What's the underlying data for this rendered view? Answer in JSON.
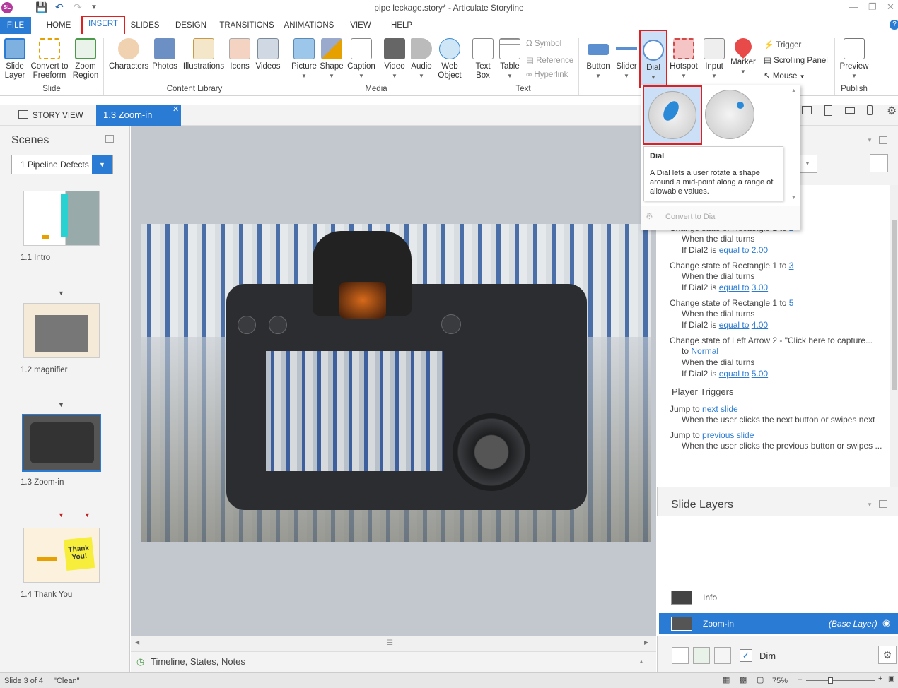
{
  "window": {
    "app_icon": "SL",
    "title": "pipe leckage.story* - Articulate Storyline"
  },
  "tabs": [
    "FILE",
    "HOME",
    "INSERT",
    "SLIDES",
    "DESIGN",
    "TRANSITIONS",
    "ANIMATIONS",
    "VIEW",
    "HELP"
  ],
  "ribbon": {
    "slide_group": {
      "label": "Slide",
      "buttons": [
        "Slide Layer",
        "Convert to Freeform",
        "Zoom Region"
      ]
    },
    "content_library": {
      "label": "Content Library",
      "buttons": [
        "Characters",
        "Photos",
        "Illustrations",
        "Icons",
        "Videos"
      ]
    },
    "media": {
      "label": "Media",
      "buttons": [
        "Picture",
        "Shape",
        "Caption",
        "Video",
        "Audio",
        "Web Object"
      ]
    },
    "text": {
      "label": "Text",
      "buttons": [
        "Text Box",
        "Table"
      ],
      "small": [
        "Symbol",
        "Reference",
        "Hyperlink"
      ]
    },
    "interactive": {
      "buttons": [
        "Button",
        "Slider",
        "Dial",
        "Hotspot",
        "Input",
        "Marker"
      ],
      "small": [
        "Trigger",
        "Scrolling Panel",
        "Mouse"
      ]
    },
    "publish": {
      "label": "Publish",
      "buttons": [
        "Preview"
      ]
    }
  },
  "view_tabs": {
    "story_view": "STORY VIEW",
    "current": "1.3 Zoom-in"
  },
  "scenes": {
    "title": "Scenes",
    "dropdown": "1 Pipeline Defects",
    "slides": [
      {
        "label": "1.1 Intro"
      },
      {
        "label": "1.2 magnifier"
      },
      {
        "label": "1.3 Zoom-in"
      },
      {
        "label": "1.4 Thank You",
        "sticky_text": "Thank You!"
      }
    ]
  },
  "dial_dropdown": {
    "tooltip_title": "Dial",
    "tooltip_text": "A Dial lets a user rotate a shape around a mid-point along a range of allowable values.",
    "convert": "Convert to Dial"
  },
  "triggers": {
    "cut_line": "Change state of Rectangle 1 to",
    "cut_value": "2",
    "items": [
      {
        "when": "When the dial turns",
        "if": "If Dial2 is",
        "cond": "equal to",
        "val": "2.00"
      },
      {
        "action": "Change state of Rectangle 1 to",
        "target": "3",
        "when": "When the dial turns",
        "if": "If Dial2 is",
        "cond": "equal to",
        "val": "3.00"
      },
      {
        "action": "Change state of Rectangle 1 to",
        "target": "5",
        "when": "When the dial turns",
        "if": "If Dial2 is",
        "cond": "equal to",
        "val": "4.00"
      },
      {
        "action": "Change state of Left Arrow 2 - \"Click here to capture...",
        "to": "to",
        "target": "Normal",
        "when": "When the dial turns",
        "if": "If Dial2 is",
        "cond": "equal to",
        "val": "5.00"
      }
    ],
    "player_title": "Player Triggers",
    "player": [
      {
        "action": "Jump to",
        "target": "next slide",
        "when": "When the user clicks the next button or swipes next"
      },
      {
        "action": "Jump to",
        "target": "previous slide",
        "when": "When the user clicks the previous button or swipes ..."
      }
    ]
  },
  "layers": {
    "title": "Slide Layers",
    "items": [
      {
        "name": "Info"
      },
      {
        "name": "Zoom-in",
        "tag": "(Base Layer)"
      }
    ],
    "dim": "Dim"
  },
  "notes_bar": "Timeline, States, Notes",
  "status": {
    "slide": "Slide 3 of 4",
    "theme": "\"Clean\"",
    "zoom": "75%"
  },
  "colors": {
    "accent": "#2a7bd3",
    "highlight": "#e02020"
  }
}
